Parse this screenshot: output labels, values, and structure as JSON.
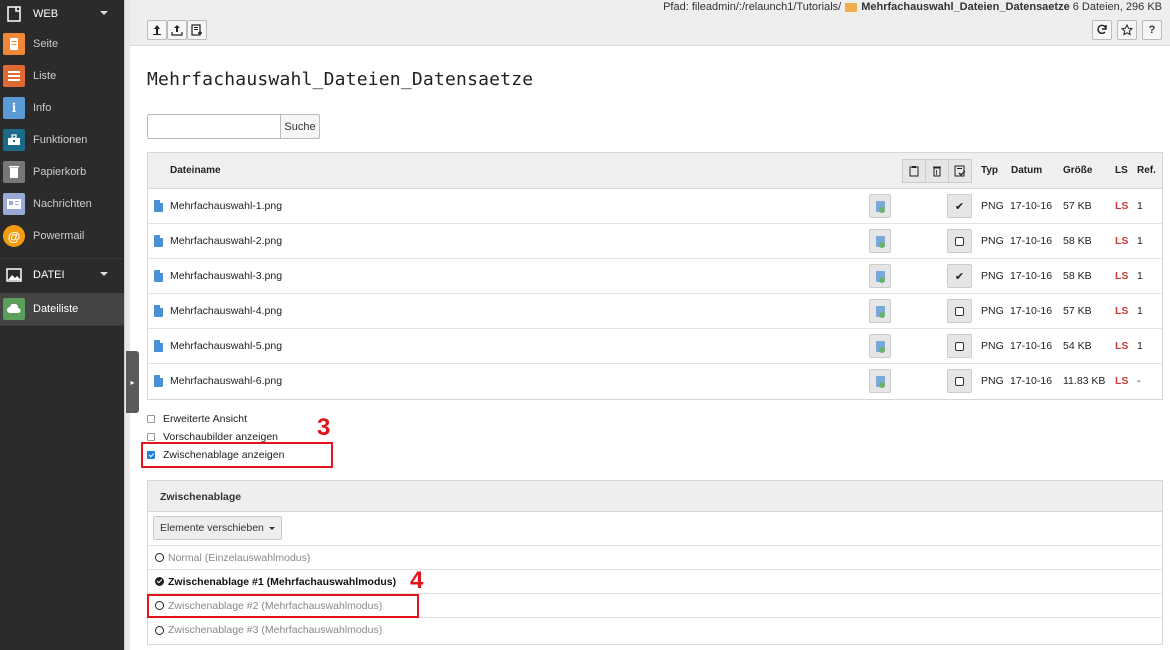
{
  "sidebar": {
    "groups": [
      {
        "label": "WEB",
        "icon": "web-icon"
      },
      {
        "label": "DATEI",
        "icon": "image-icon"
      }
    ],
    "web_items": [
      {
        "label": "Seite",
        "icon": "page-icon",
        "color": "#f0883a"
      },
      {
        "label": "Liste",
        "icon": "list-icon",
        "color": "#e06a35"
      },
      {
        "label": "Info",
        "icon": "info-icon",
        "color": "#5b9bd5"
      },
      {
        "label": "Funktionen",
        "icon": "toolbox-icon",
        "color": "#1a6b8a"
      },
      {
        "label": "Papierkorb",
        "icon": "trash-icon",
        "color": "#777777"
      },
      {
        "label": "Nachrichten",
        "icon": "news-icon",
        "color": "#9aa9d6"
      },
      {
        "label": "Powermail",
        "icon": "powermail-icon",
        "color": "#f39c12"
      }
    ],
    "datei_items": [
      {
        "label": "Dateiliste",
        "icon": "filelist-icon",
        "color": "#5c9f5c"
      }
    ]
  },
  "header": {
    "path_label": "Pfad: fileadmin/:/relaunch1/Tutorials/",
    "folder_name": "Mehrfachauswahl_Dateien_Datensaetze",
    "folder_info": "6 Dateien, 296 KB",
    "help_label": "?"
  },
  "page": {
    "title": "Mehrfachauswahl_Dateien_Datensaetze",
    "search_placeholder": "",
    "search_button": "Suche"
  },
  "table": {
    "headers": {
      "name": "Dateiname",
      "type": "Typ",
      "date": "Datum",
      "size": "Größe",
      "ls": "LS",
      "ref": "Ref."
    },
    "rows": [
      {
        "name": "Mehrfachauswahl-1.png",
        "type": "PNG",
        "date": "17-10-16",
        "size": "57 KB",
        "ls": "LS",
        "ref": "1",
        "selected": true
      },
      {
        "name": "Mehrfachauswahl-2.png",
        "type": "PNG",
        "date": "17-10-16",
        "size": "58 KB",
        "ls": "LS",
        "ref": "1",
        "selected": false
      },
      {
        "name": "Mehrfachauswahl-3.png",
        "type": "PNG",
        "date": "17-10-16",
        "size": "58 KB",
        "ls": "LS",
        "ref": "1",
        "selected": true
      },
      {
        "name": "Mehrfachauswahl-4.png",
        "type": "PNG",
        "date": "17-10-16",
        "size": "57 KB",
        "ls": "LS",
        "ref": "1",
        "selected": false
      },
      {
        "name": "Mehrfachauswahl-5.png",
        "type": "PNG",
        "date": "17-10-16",
        "size": "54 KB",
        "ls": "LS",
        "ref": "1",
        "selected": false
      },
      {
        "name": "Mehrfachauswahl-6.png",
        "type": "PNG",
        "date": "17-10-16",
        "size": "11.83 KB",
        "ls": "LS",
        "ref": "-",
        "selected": false
      }
    ]
  },
  "options": {
    "extended_view": "Erweiterte Ansicht",
    "thumbnails": "Vorschaubilder anzeigen",
    "show_clipboard": "Zwischenablage anzeigen"
  },
  "annotations": {
    "marker_3": "3",
    "marker_4": "4"
  },
  "clipboard": {
    "title": "Zwischenablage",
    "action_dropdown": "Elemente verschieben",
    "modes": [
      {
        "label": "Normal (Einzelauswahlmodus)",
        "active": false
      },
      {
        "label": "Zwischenablage #1 (Mehrfachauswahlmodus)",
        "active": true
      },
      {
        "label": "Zwischenablage #2 (Mehrfachauswahlmodus)",
        "active": false
      },
      {
        "label": "Zwischenablage #3 (Mehrfachauswahlmodus)",
        "active": false
      }
    ]
  },
  "colors": {
    "sidebar_bg": "#2b2b2b",
    "highlight_red": "#e3141a",
    "ls_red": "#c83c3c",
    "check_blue": "#1e80d6"
  }
}
